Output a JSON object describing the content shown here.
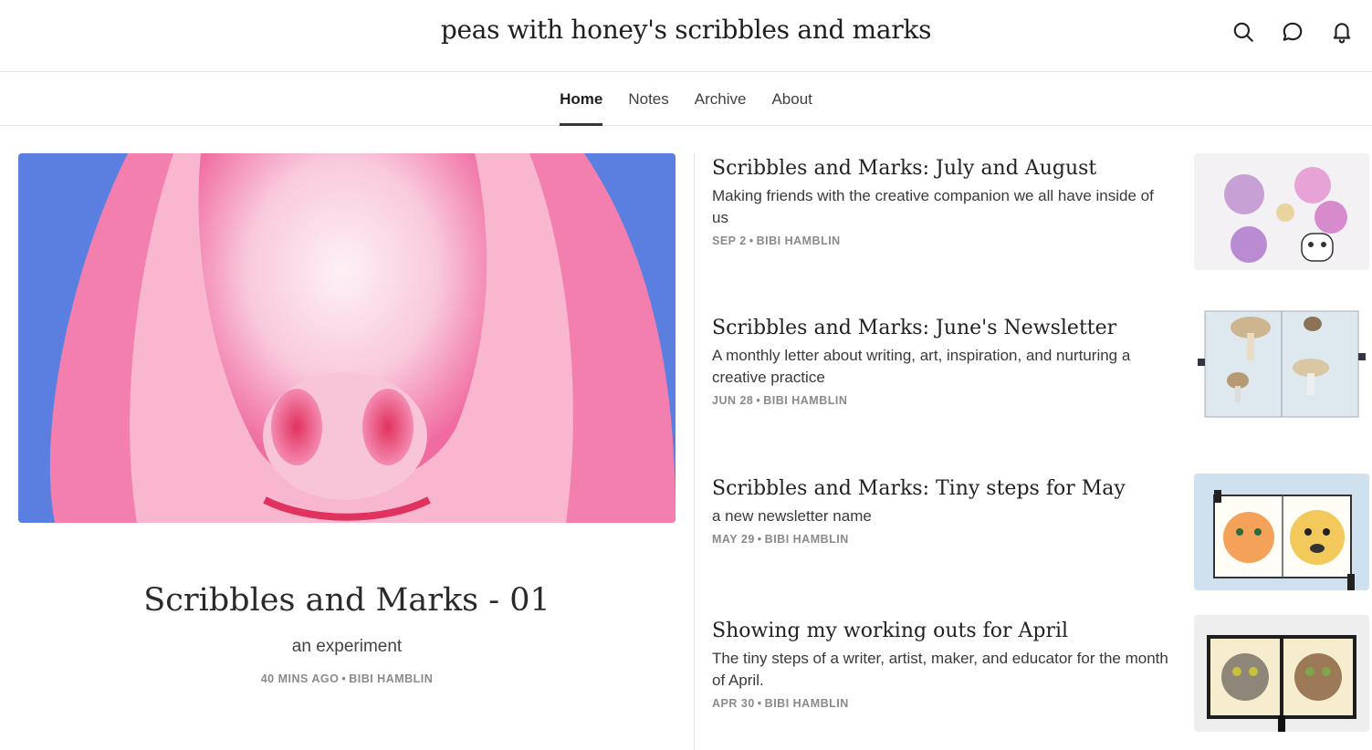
{
  "site": {
    "title": "peas with honey's scribbles and marks"
  },
  "icons": {
    "search": "search-icon",
    "chat": "chat-icon",
    "bell": "bell-icon"
  },
  "nav": [
    {
      "label": "Home",
      "active": true
    },
    {
      "label": "Notes",
      "active": false
    },
    {
      "label": "Archive",
      "active": false
    },
    {
      "label": "About",
      "active": false
    }
  ],
  "hero": {
    "title": "Scribbles and Marks - 01",
    "subtitle": "an experiment",
    "date": "40 MINS AGO",
    "author": "BIBI HAMBLIN",
    "image": "pink-horse-photo"
  },
  "posts": [
    {
      "title": "Scribbles and Marks: July and August",
      "subtitle": "Making friends with the creative companion we all have inside of us",
      "date": "SEP 2",
      "author": "BIBI HAMBLIN",
      "image": "flower-and-cat-sketch"
    },
    {
      "title": "Scribbles and Marks: June's Newsletter",
      "subtitle": "A monthly letter about writing, art, inspiration, and nurturing a creative practice",
      "date": "JUN 28",
      "author": "BIBI HAMBLIN",
      "image": "mushroom-sketchbook"
    },
    {
      "title": "Scribbles and Marks: Tiny steps for May",
      "subtitle": "a new newsletter name",
      "date": "MAY 29",
      "author": "BIBI HAMBLIN",
      "image": "cat-and-dog-sketchbook"
    },
    {
      "title": "Showing my working outs for April",
      "subtitle": "The tiny steps of a writer, artist, maker, and educator for the month of April.",
      "date": "APR 30",
      "author": "BIBI HAMBLIN",
      "image": "two-cats-sketchbook"
    }
  ],
  "meta_separator": "•",
  "colors": {
    "text": "#363737",
    "border": "#e6e6e6",
    "meta": "#8a8a8a",
    "hero_bg": "#5b7fe0",
    "hero_pink": "#f06ba0"
  }
}
